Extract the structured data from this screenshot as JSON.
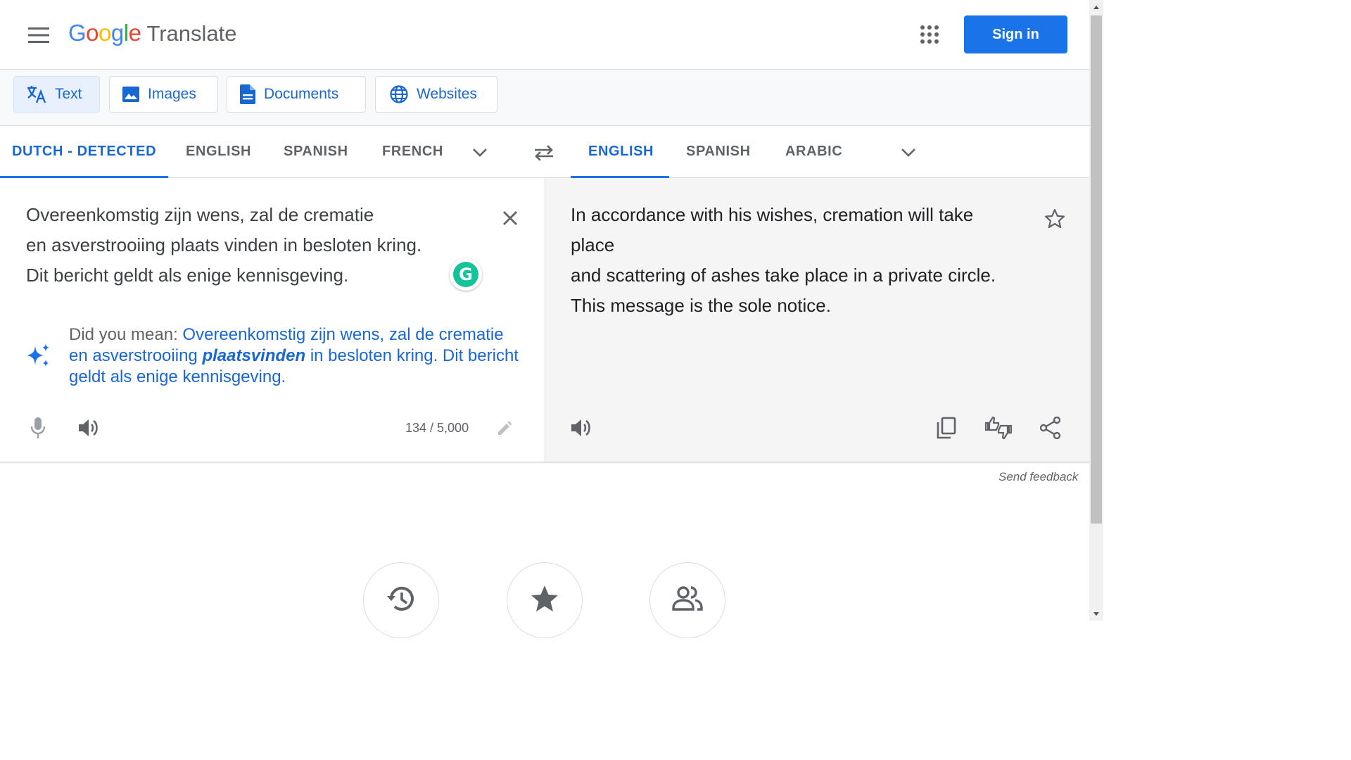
{
  "header": {
    "logo_google": "Google",
    "logo_product": "Translate",
    "sign_in_label": "Sign in"
  },
  "mode_tabs": [
    {
      "label": "Text",
      "icon": "translate-icon",
      "active": true
    },
    {
      "label": "Images",
      "icon": "image-icon",
      "active": false
    },
    {
      "label": "Documents",
      "icon": "document-icon",
      "active": false
    },
    {
      "label": "Websites",
      "icon": "globe-icon",
      "active": false
    }
  ],
  "source_languages": [
    "DUTCH - DETECTED",
    "ENGLISH",
    "SPANISH",
    "FRENCH"
  ],
  "target_languages": [
    "ENGLISH",
    "SPANISH",
    "ARABIC"
  ],
  "source": {
    "lines": [
      "Overeenkomstig zijn wens, zal de crematie",
      "en asverstrooiing plaats vinden in besloten kring.",
      "Dit bericht geldt als enige kennisgeving."
    ],
    "char_count": "134 / 5,000",
    "grammarly_letter": "G"
  },
  "did_you_mean": {
    "prefix": "Did you mean: ",
    "before": "Overeenkomstig zijn wens, zal de crematie en asverstrooiing ",
    "emphasis": "plaatsvinden",
    "after": " in besloten kring. Dit bericht geldt als enige kennisgeving."
  },
  "target": {
    "lines": [
      "In accordance with his wishes, cremation will take",
      "place",
      "and scattering of ashes take place in a private circle.",
      "This message is the sole notice."
    ]
  },
  "feedback_label": "Send feedback",
  "bottom_buttons": [
    "history-icon",
    "star-icon",
    "community-icon"
  ],
  "colors": {
    "accent": "#1a73e8",
    "active_text": "#1967d2",
    "target_bg": "#f5f5f5",
    "grammarly": "#15c39a"
  }
}
